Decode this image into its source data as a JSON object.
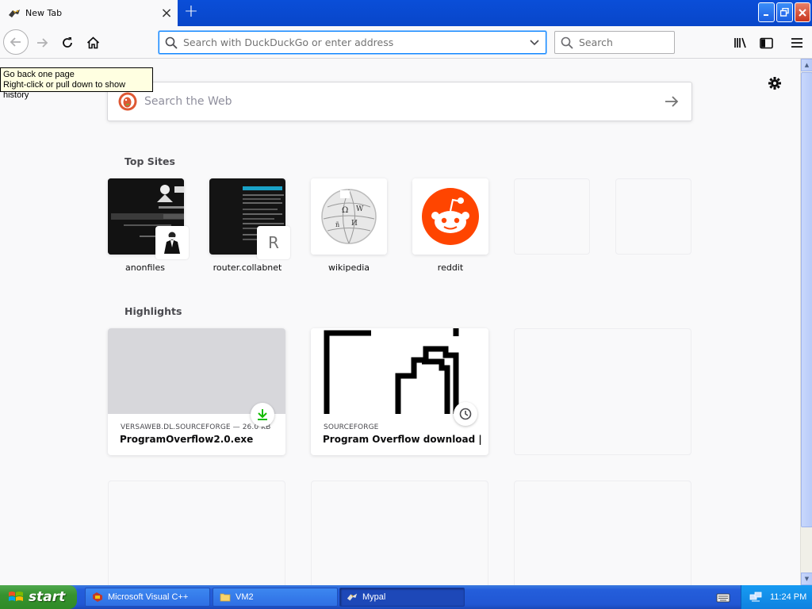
{
  "browser": {
    "tab": {
      "title": "New Tab"
    },
    "urlbar": {
      "placeholder": "Search with DuckDuckGo or enter address"
    },
    "searchbar": {
      "placeholder": "Search"
    },
    "tooltip": {
      "line1": "Go back one page",
      "line2": "Right-click or pull down to show history"
    }
  },
  "newtab": {
    "websearch": {
      "placeholder": "Search the Web"
    },
    "topsites": {
      "title": "Top Sites",
      "items": [
        {
          "label": "anonfiles"
        },
        {
          "label": "router.collabnet",
          "badge_letter": "R"
        },
        {
          "label": "wikipedia"
        },
        {
          "label": "reddit"
        }
      ]
    },
    "highlights": {
      "title": "Highlights",
      "items": [
        {
          "source": "VERSAWEB.DL.SOURCEFORGE — 26.0 KB",
          "title": "ProgramOverflow2.0.exe",
          "type": "download"
        },
        {
          "source": "SOURCEFORGE",
          "title": "Program Overflow download | S...",
          "type": "history"
        }
      ]
    }
  },
  "taskbar": {
    "start_label": "start",
    "tasks": [
      {
        "label": "Microsoft Visual C++"
      },
      {
        "label": "VM2"
      },
      {
        "label": "Mypal",
        "active": true
      }
    ],
    "clock": "11:24 PM"
  },
  "colors": {
    "accent": "#0a84ff",
    "reddit": "#ff4500",
    "download_green": "#12bc00",
    "xp_blue": "#245edb"
  }
}
